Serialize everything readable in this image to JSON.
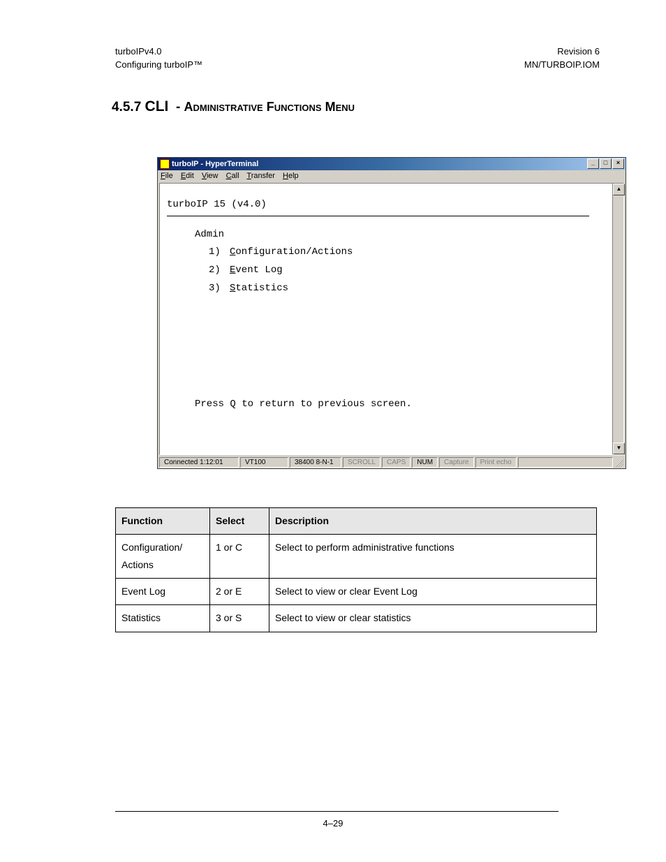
{
  "header": {
    "left_line1": "turboIPv4.0",
    "left_line2": "Configuring turboIP™",
    "right_line1": "Revision 6",
    "right_line2": "MN/TURBOIP.IOM"
  },
  "section": {
    "number": "4.5.7",
    "cli": "CLI",
    "dash": "-",
    "rest": "Administrative Functions Menu"
  },
  "hyperterminal": {
    "title": "turboIP - HyperTerminal",
    "menus": {
      "file": "File",
      "edit": "Edit",
      "view": "View",
      "call": "Call",
      "transfer": "Transfer",
      "help": "Help"
    },
    "terminal": {
      "title": "turboIP 15 (v4.0)",
      "heading": "Admin",
      "items": [
        {
          "num": "1)",
          "first": "C",
          "rest": "onfiguration/Actions"
        },
        {
          "num": "2)",
          "first": "E",
          "rest": "vent Log"
        },
        {
          "num": "3)",
          "first": "S",
          "rest": "tatistics"
        }
      ],
      "footer": "Press Q to return to previous screen."
    },
    "status": {
      "connected": "Connected 1:12:01",
      "emu": "VT100",
      "conn": "38400 8-N-1",
      "scroll": "SCROLL",
      "caps": "CAPS",
      "num": "NUM",
      "capture": "Capture",
      "printecho": "Print echo"
    }
  },
  "table": {
    "headers": {
      "c1": "Function",
      "c2": "Select",
      "c3": "Description"
    },
    "rows": [
      {
        "func": "Configuration/\nActions",
        "select": "1 or C",
        "desc": "Select to perform administrative functions"
      },
      {
        "func": "Event Log",
        "select": "2 or E",
        "desc": "Select to view or clear Event Log"
      },
      {
        "func": "Statistics",
        "select": "3 or S",
        "desc": "Select to view or clear statistics"
      }
    ]
  },
  "pagenum": "4–29"
}
